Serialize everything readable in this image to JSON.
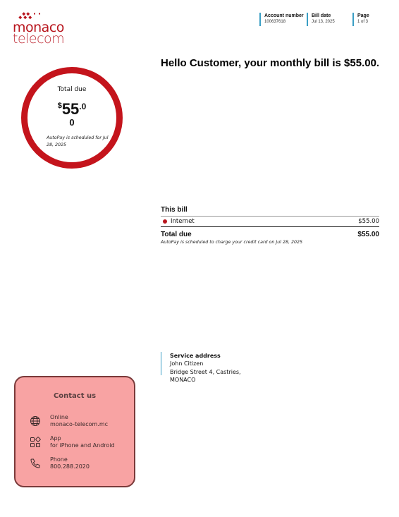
{
  "brand": {
    "name_line1": "monaco",
    "name_line2": "telecom",
    "color": "#b8141c"
  },
  "header": {
    "account_label": "Account number",
    "account_value": "100637618",
    "date_label": "Bill date",
    "date_value": "Jul 13, 2025",
    "page_label": "Page",
    "page_value": "1 of 3",
    "accent_color": "#3a9ec4"
  },
  "headline": "Hello Customer, your monthly bill is $55.00.",
  "total_due_circle": {
    "label": "Total due",
    "currency": "$",
    "whole": "55",
    "cents": ".0",
    "extra_digit": "0",
    "note": "AutoPay is scheduled for Jul 28, 2025",
    "ring_color": "#c4141c"
  },
  "this_bill": {
    "title": "This bill",
    "items": [
      {
        "name": "Internet",
        "amount": "$55.00"
      }
    ],
    "total_label": "Total due",
    "total_amount": "$55.00",
    "autopay_note": "AutoPay is scheduled to charge your credit card on Jul 28, 2025"
  },
  "service_address": {
    "label": "Service address",
    "lines": [
      "John Citizen",
      "Bridge Street 4, Castries,",
      "MONACO"
    ]
  },
  "contact": {
    "title": "Contact us",
    "background": "#f8a3a3",
    "items": [
      {
        "icon": "globe-icon",
        "line1": "Online",
        "line2": "monaco-telecom.mc"
      },
      {
        "icon": "app-grid-icon",
        "line1": "App",
        "line2": "for iPhone and Android"
      },
      {
        "icon": "phone-icon",
        "line1": "Phone",
        "line2": "800.288.2020"
      }
    ]
  }
}
